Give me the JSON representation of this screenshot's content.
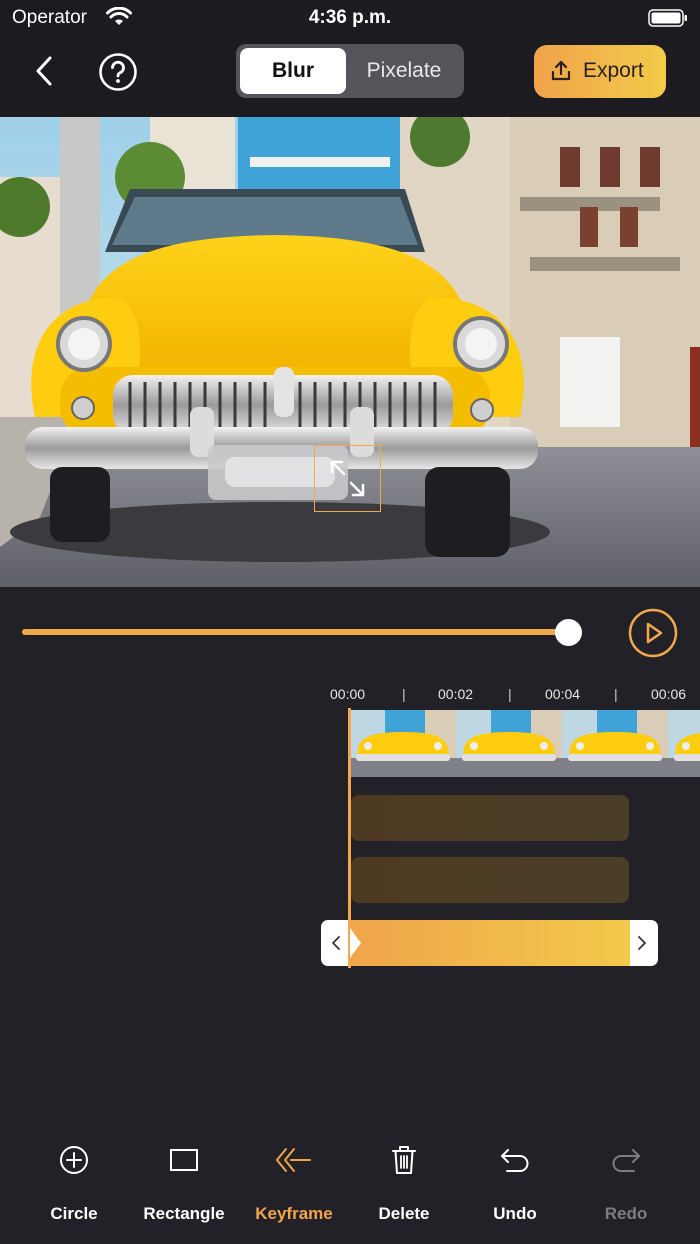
{
  "status_bar": {
    "carrier": "Operator",
    "time": "4:36 p.m."
  },
  "header": {
    "modes": [
      {
        "label": "Blur",
        "selected": true
      },
      {
        "label": "Pixelate",
        "selected": false
      }
    ],
    "export_label": "Export",
    "back_icon": "chevron-left-icon",
    "help_icon": "question-circle-icon"
  },
  "player": {
    "progress": 1.0,
    "play_icon": "play-circle-icon"
  },
  "timeline": {
    "ticks": [
      "00:00",
      "00:02",
      "00:04",
      "00:06"
    ]
  },
  "toolbar": {
    "items": [
      {
        "label": "Circle",
        "icon": "plus-circle-icon",
        "state": "normal"
      },
      {
        "label": "Rectangle",
        "icon": "rectangle-icon",
        "state": "normal"
      },
      {
        "label": "Keyframe",
        "icon": "keyframe-icon",
        "state": "active"
      },
      {
        "label": "Delete",
        "icon": "trash-icon",
        "state": "normal"
      },
      {
        "label": "Undo",
        "icon": "undo-icon",
        "state": "normal"
      },
      {
        "label": "Redo",
        "icon": "redo-icon",
        "state": "disabled"
      }
    ]
  },
  "colors": {
    "accent": "#f2a94c",
    "background": "#222127",
    "selection_gradient_end": "#f2c94a"
  }
}
